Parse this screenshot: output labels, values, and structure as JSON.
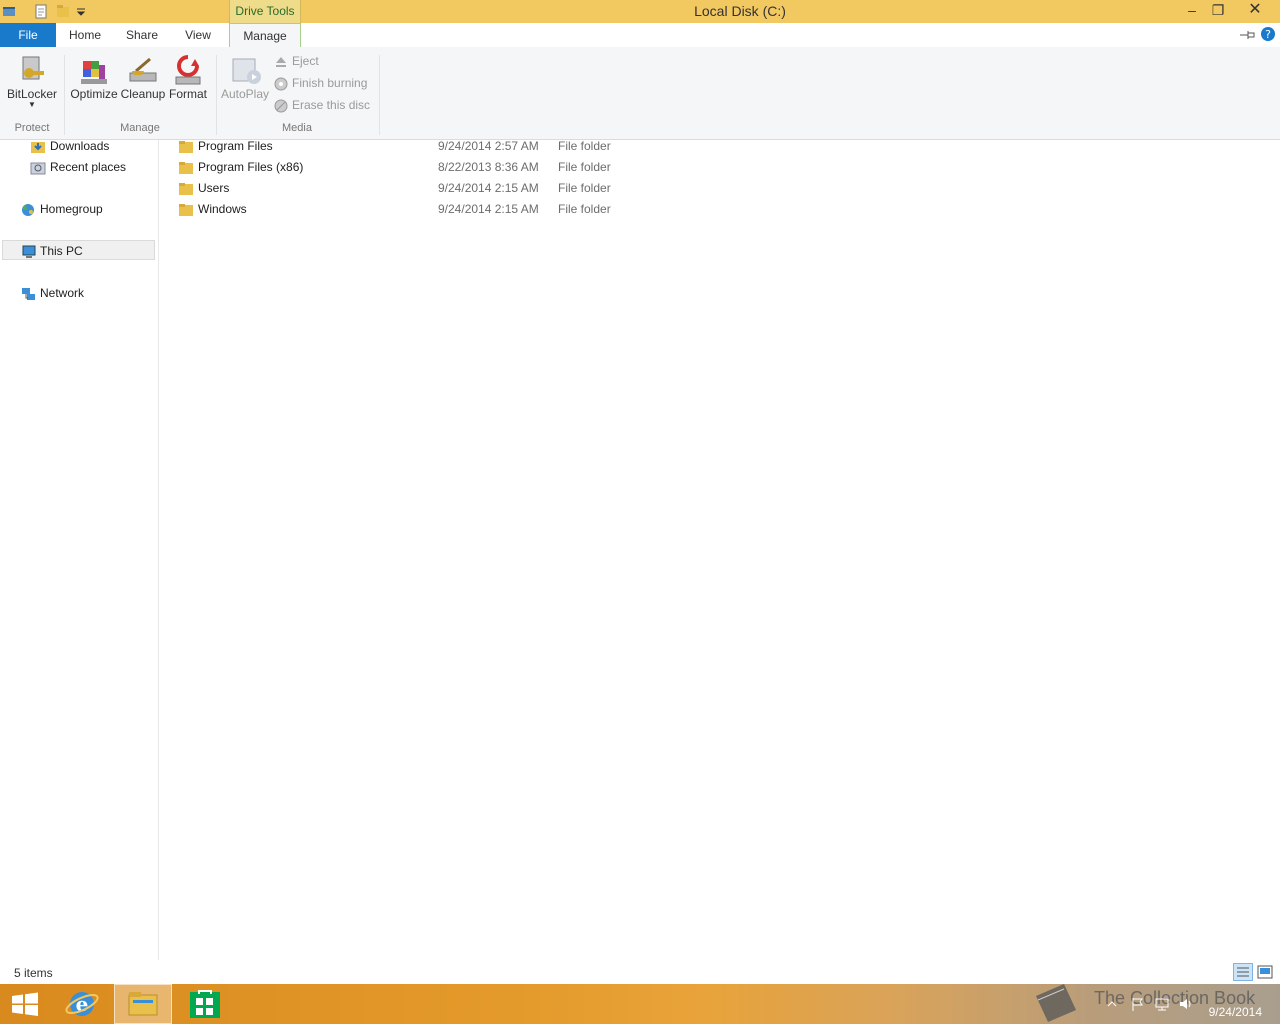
{
  "window": {
    "title": "Local Disk (C:)",
    "context_tab_group": "Drive Tools"
  },
  "tabs": {
    "file": "File",
    "home": "Home",
    "share": "Share",
    "view": "View",
    "manage": "Manage"
  },
  "ribbon": {
    "protect": {
      "label": "Protect",
      "bitlocker": "BitLocker"
    },
    "manage": {
      "label": "Manage",
      "optimize": "Optimize",
      "cleanup": "Cleanup",
      "format": "Format"
    },
    "media": {
      "label": "Media",
      "autoplay": "AutoPlay",
      "eject": "Eject",
      "finish_burning": "Finish burning",
      "erase_disc": "Erase this disc"
    }
  },
  "nav": {
    "downloads": "Downloads",
    "recent_places": "Recent places",
    "homegroup": "Homegroup",
    "this_pc": "This PC",
    "network": "Network"
  },
  "files": [
    {
      "name": "Program Files",
      "date": "9/24/2014 2:57 AM",
      "type": "File folder"
    },
    {
      "name": "Program Files (x86)",
      "date": "8/22/2013 8:36 AM",
      "type": "File folder"
    },
    {
      "name": "Users",
      "date": "9/24/2014 2:15 AM",
      "type": "File folder"
    },
    {
      "name": "Windows",
      "date": "9/24/2014 2:15 AM",
      "type": "File folder"
    }
  ],
  "status": {
    "item_count": "5 items"
  },
  "taskbar": {
    "watermark": "The Collection Book",
    "clock_date": "9/24/2014"
  },
  "colors": {
    "titlebar": "#f2c861",
    "file_tab": "#1979ca",
    "ribbon_bg": "#f5f6f7",
    "folder": "#e8c04a"
  }
}
